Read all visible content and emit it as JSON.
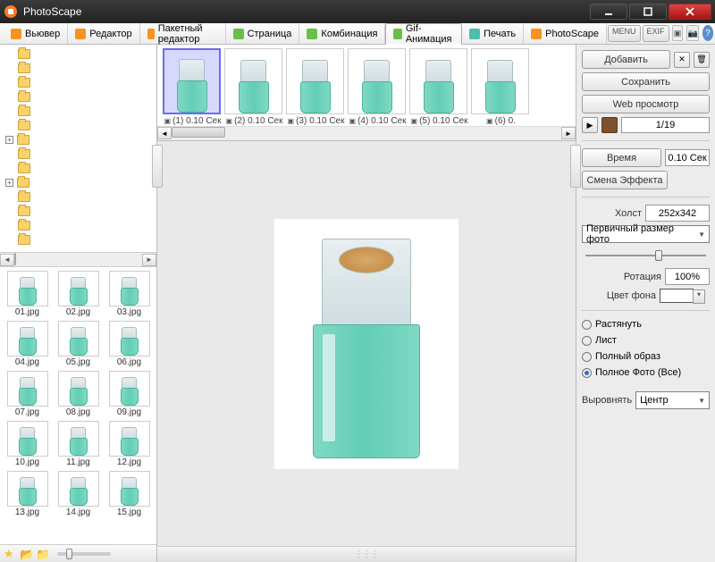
{
  "app": {
    "title": "PhotoScape"
  },
  "tabs": [
    {
      "label": "Вьювер"
    },
    {
      "label": "Редактор"
    },
    {
      "label": "Пакетный редактор"
    },
    {
      "label": "Страница"
    },
    {
      "label": "Комбинация"
    },
    {
      "label": "Gif-Анимация"
    },
    {
      "label": "Печать"
    },
    {
      "label": "PhotoScape"
    }
  ],
  "headmini": {
    "menu": "MENU",
    "exif": "EXIF"
  },
  "frames": [
    {
      "label": "(1) 0.10 Сек"
    },
    {
      "label": "(2) 0.10 Сек"
    },
    {
      "label": "(3) 0.10 Сек"
    },
    {
      "label": "(4) 0.10 Сек"
    },
    {
      "label": "(5) 0.10 Сек"
    },
    {
      "label": "(6) 0."
    }
  ],
  "thumbs": [
    {
      "label": "01.jpg"
    },
    {
      "label": "02.jpg"
    },
    {
      "label": "03.jpg"
    },
    {
      "label": "04.jpg"
    },
    {
      "label": "05.jpg"
    },
    {
      "label": "06.jpg"
    },
    {
      "label": "07.jpg"
    },
    {
      "label": "08.jpg"
    },
    {
      "label": "09.jpg"
    },
    {
      "label": "10.jpg"
    },
    {
      "label": "11.jpg"
    },
    {
      "label": "12.jpg"
    },
    {
      "label": "13.jpg"
    },
    {
      "label": "14.jpg"
    },
    {
      "label": "15.jpg"
    }
  ],
  "right": {
    "add": "Добавить",
    "save": "Сохранить",
    "webpreview": "Web просмотр",
    "counter": "1/19",
    "time_btn": "Время",
    "time_val": "0.10 Сек",
    "effect": "Смена Эффекта",
    "canvas_label": "Холст",
    "canvas_val": "252x342",
    "sizemode": "Первичный размер фото",
    "rotation_label": "Ротация",
    "rotation_val": "100%",
    "bgcolor_label": "Цвет фона",
    "fit_stretch": "Растянуть",
    "fit_sheet": "Лист",
    "fit_full": "Полный образ",
    "fit_fullall": "Полное Фото (Все)",
    "align_label": "Выровнять",
    "align_val": "Центр"
  }
}
